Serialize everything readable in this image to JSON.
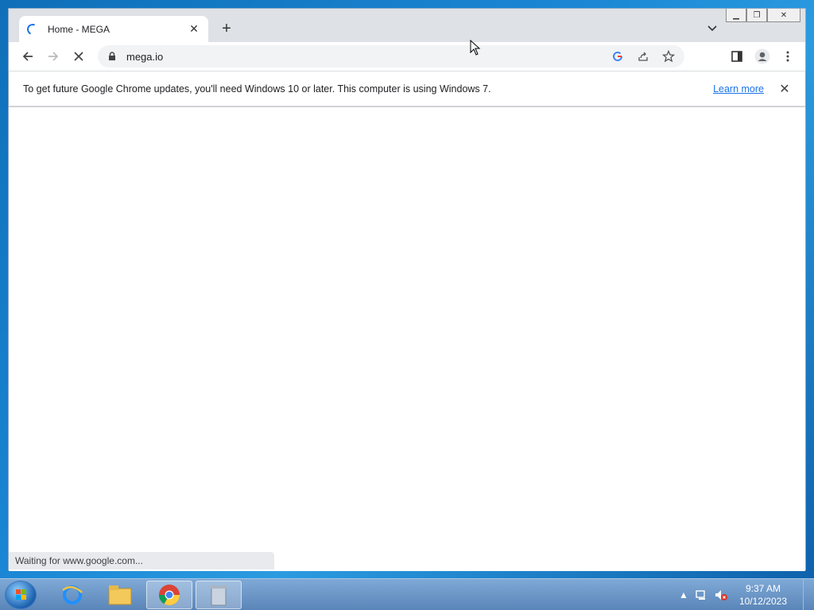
{
  "browser": {
    "tab": {
      "title": "Home - MEGA"
    },
    "omnibox": {
      "url": "mega.io"
    },
    "infobar": {
      "message": "To get future Google Chrome updates, you'll need Windows 10 or later. This computer is using Windows 7.",
      "link": "Learn more"
    },
    "status": "Waiting for www.google.com..."
  },
  "taskbar": {
    "apps": [
      "internet-explorer-icon",
      "file-explorer-icon",
      "chrome-icon",
      "recycle-app-icon"
    ],
    "clock": {
      "time": "9:37 AM",
      "date": "10/12/2023"
    }
  },
  "colors": {
    "accent": "#1a73e8",
    "taskbar": "#5a85b8"
  }
}
